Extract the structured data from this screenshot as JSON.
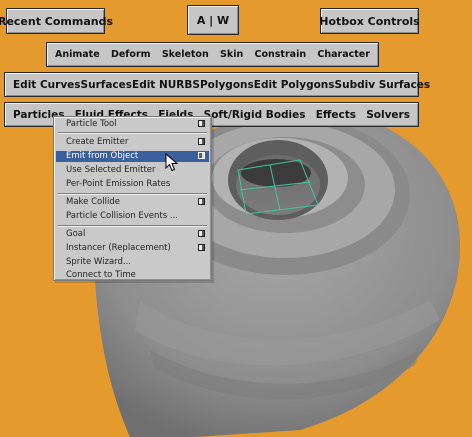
{
  "hotbox": {
    "recent_commands": "Recent Commands",
    "aw": "A | W",
    "hotbox_controls": "Hotbox Controls"
  },
  "menu_sets": [
    "Animate",
    "Deform",
    "Skeleton",
    "Skin",
    "Constrain",
    "Character"
  ],
  "modeling_menus": [
    "Edit Curves",
    "Surfaces",
    "Edit NURBS",
    "Polygons",
    "Edit Polygons",
    "Subdiv Surfaces"
  ],
  "dynamics_menus": [
    "Particles",
    "Fluid Effects",
    "Fields",
    "Soft/Rigid Bodies",
    "Effects",
    "Solvers"
  ],
  "particles_menu": {
    "items": [
      {
        "label": "Particle Tool",
        "option": true
      },
      {
        "label": "Create Emitter",
        "option": true
      },
      {
        "label": "Emit from Object",
        "option": true,
        "highlighted": true
      },
      {
        "label": "Use Selected Emitter",
        "option": false
      },
      {
        "label": "Per-Point Emission Rates",
        "option": false
      },
      {
        "label": "Make Collide",
        "option": true
      },
      {
        "label": "Particle Collision Events ...",
        "option": false
      },
      {
        "label": "Goal",
        "option": true
      },
      {
        "label": "Instancer (Replacement)",
        "option": true
      },
      {
        "label": "Sprite Wizard...",
        "option": false
      },
      {
        "label": "Connect to Time",
        "option": false
      }
    ]
  },
  "colors": {
    "background": "#e59a2e",
    "button_face": "#c6c6c6",
    "menu_highlight": "#3c5f9e",
    "wireframe": "#3fc9a0"
  },
  "icons": {
    "option_box": "option-box-icon",
    "cursor": "mouse-cursor-icon"
  }
}
